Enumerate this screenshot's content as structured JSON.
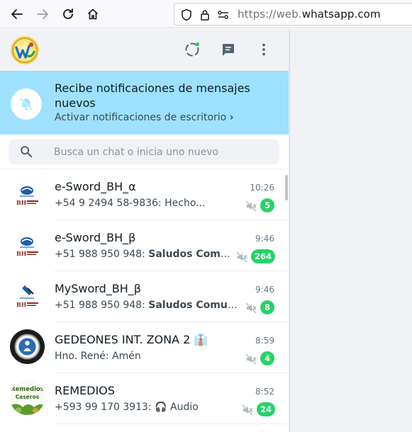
{
  "browser": {
    "url_prefix": "https://web.",
    "url_host": "whatsapp.com"
  },
  "notification": {
    "title": "Recibe notificaciones de mensajes nuevos",
    "link_label": "Activar notificaciones de escritorio",
    "link_chevron": "›"
  },
  "search": {
    "placeholder": "Busca un chat o inicia uno nuevo"
  },
  "chats": [
    {
      "name": "e-Sword_BH_α",
      "time": "10:26",
      "sender": "+54 9 2494 58-9836:",
      "message": "Hecho...",
      "message_bold": false,
      "unread": "5",
      "muted": true
    },
    {
      "name": "e-Sword_BH_β",
      "time": "9:46",
      "sender": "+51 988 950 948:",
      "message": "Saludos Comunidad",
      "message_bold": true,
      "unread": "264",
      "muted": true
    },
    {
      "name": "MySword_BH_β",
      "time": "9:46",
      "sender": "+51 988 950 948:",
      "message": "Saludos Comunidad",
      "message_bold": true,
      "unread": "8",
      "muted": true
    },
    {
      "name": "GEDEONES INT. ZONA 2 👔",
      "time": "8:59",
      "sender": "Hno. René:",
      "message": "Amén",
      "message_bold": false,
      "unread": "4",
      "muted": true
    },
    {
      "name": "REMEDIOS",
      "time": "8:52",
      "sender": "+593 99 170 3913:",
      "message": "🎧 Audio",
      "message_bold": false,
      "unread": "24",
      "muted": true
    }
  ],
  "avatar_labels": {
    "remedios_top": "Remedios",
    "remedios_bottom": "Caseros"
  },
  "colors": {
    "accent_green": "#25d366",
    "banner_blue": "#9de1fe"
  }
}
